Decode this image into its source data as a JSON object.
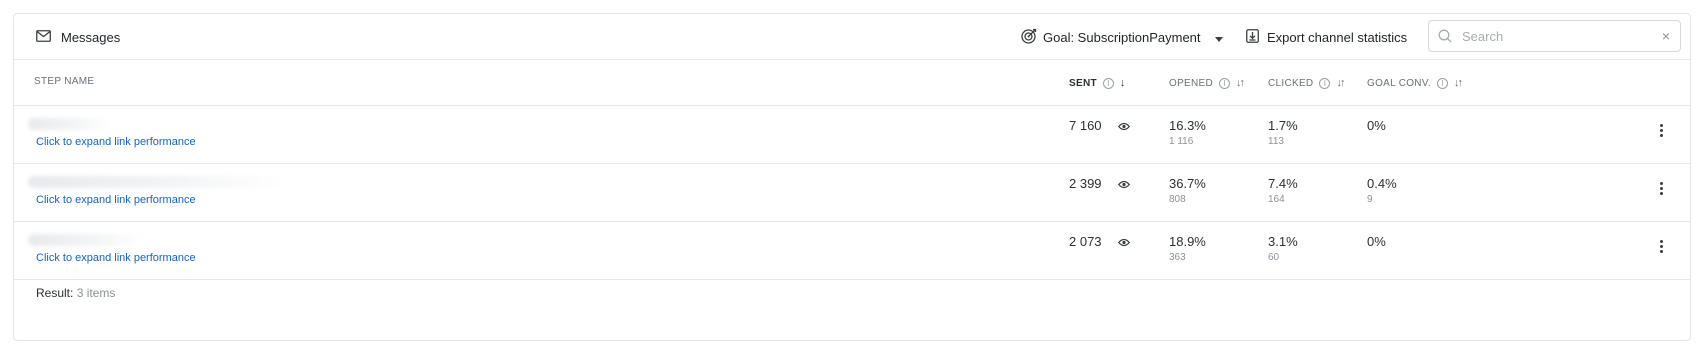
{
  "toolbar": {
    "title": "Messages",
    "goal_label": "Goal: SubscriptionPayment",
    "export_label": "Export channel statistics",
    "search_placeholder": "Search",
    "clear_glyph": "×"
  },
  "columns": {
    "step_name": "STEP NAME",
    "sent": "SENT",
    "opened": "OPENED",
    "clicked": "CLICKED",
    "goal_conv": "GOAL CONV."
  },
  "rows": [
    {
      "link": "Click to expand link performance",
      "sent": "7 160",
      "opened": "16.3%",
      "opened_count": "1 116",
      "clicked": "1.7%",
      "clicked_count": "113",
      "goal_conv": "0%",
      "goal_count": ""
    },
    {
      "link": "Click to expand link performance",
      "sent": "2 399",
      "opened": "36.7%",
      "opened_count": "808",
      "clicked": "7.4%",
      "clicked_count": "164",
      "goal_conv": "0.4%",
      "goal_count": "9"
    },
    {
      "link": "Click to expand link performance",
      "sent": "2 073",
      "opened": "18.9%",
      "opened_count": "363",
      "clicked": "3.1%",
      "clicked_count": "60",
      "goal_conv": "0%",
      "goal_count": ""
    }
  ],
  "footer": {
    "label": "Result:",
    "count": "3 items"
  },
  "colors": {
    "link": "#1565c0",
    "border": "#e3e5e8"
  }
}
